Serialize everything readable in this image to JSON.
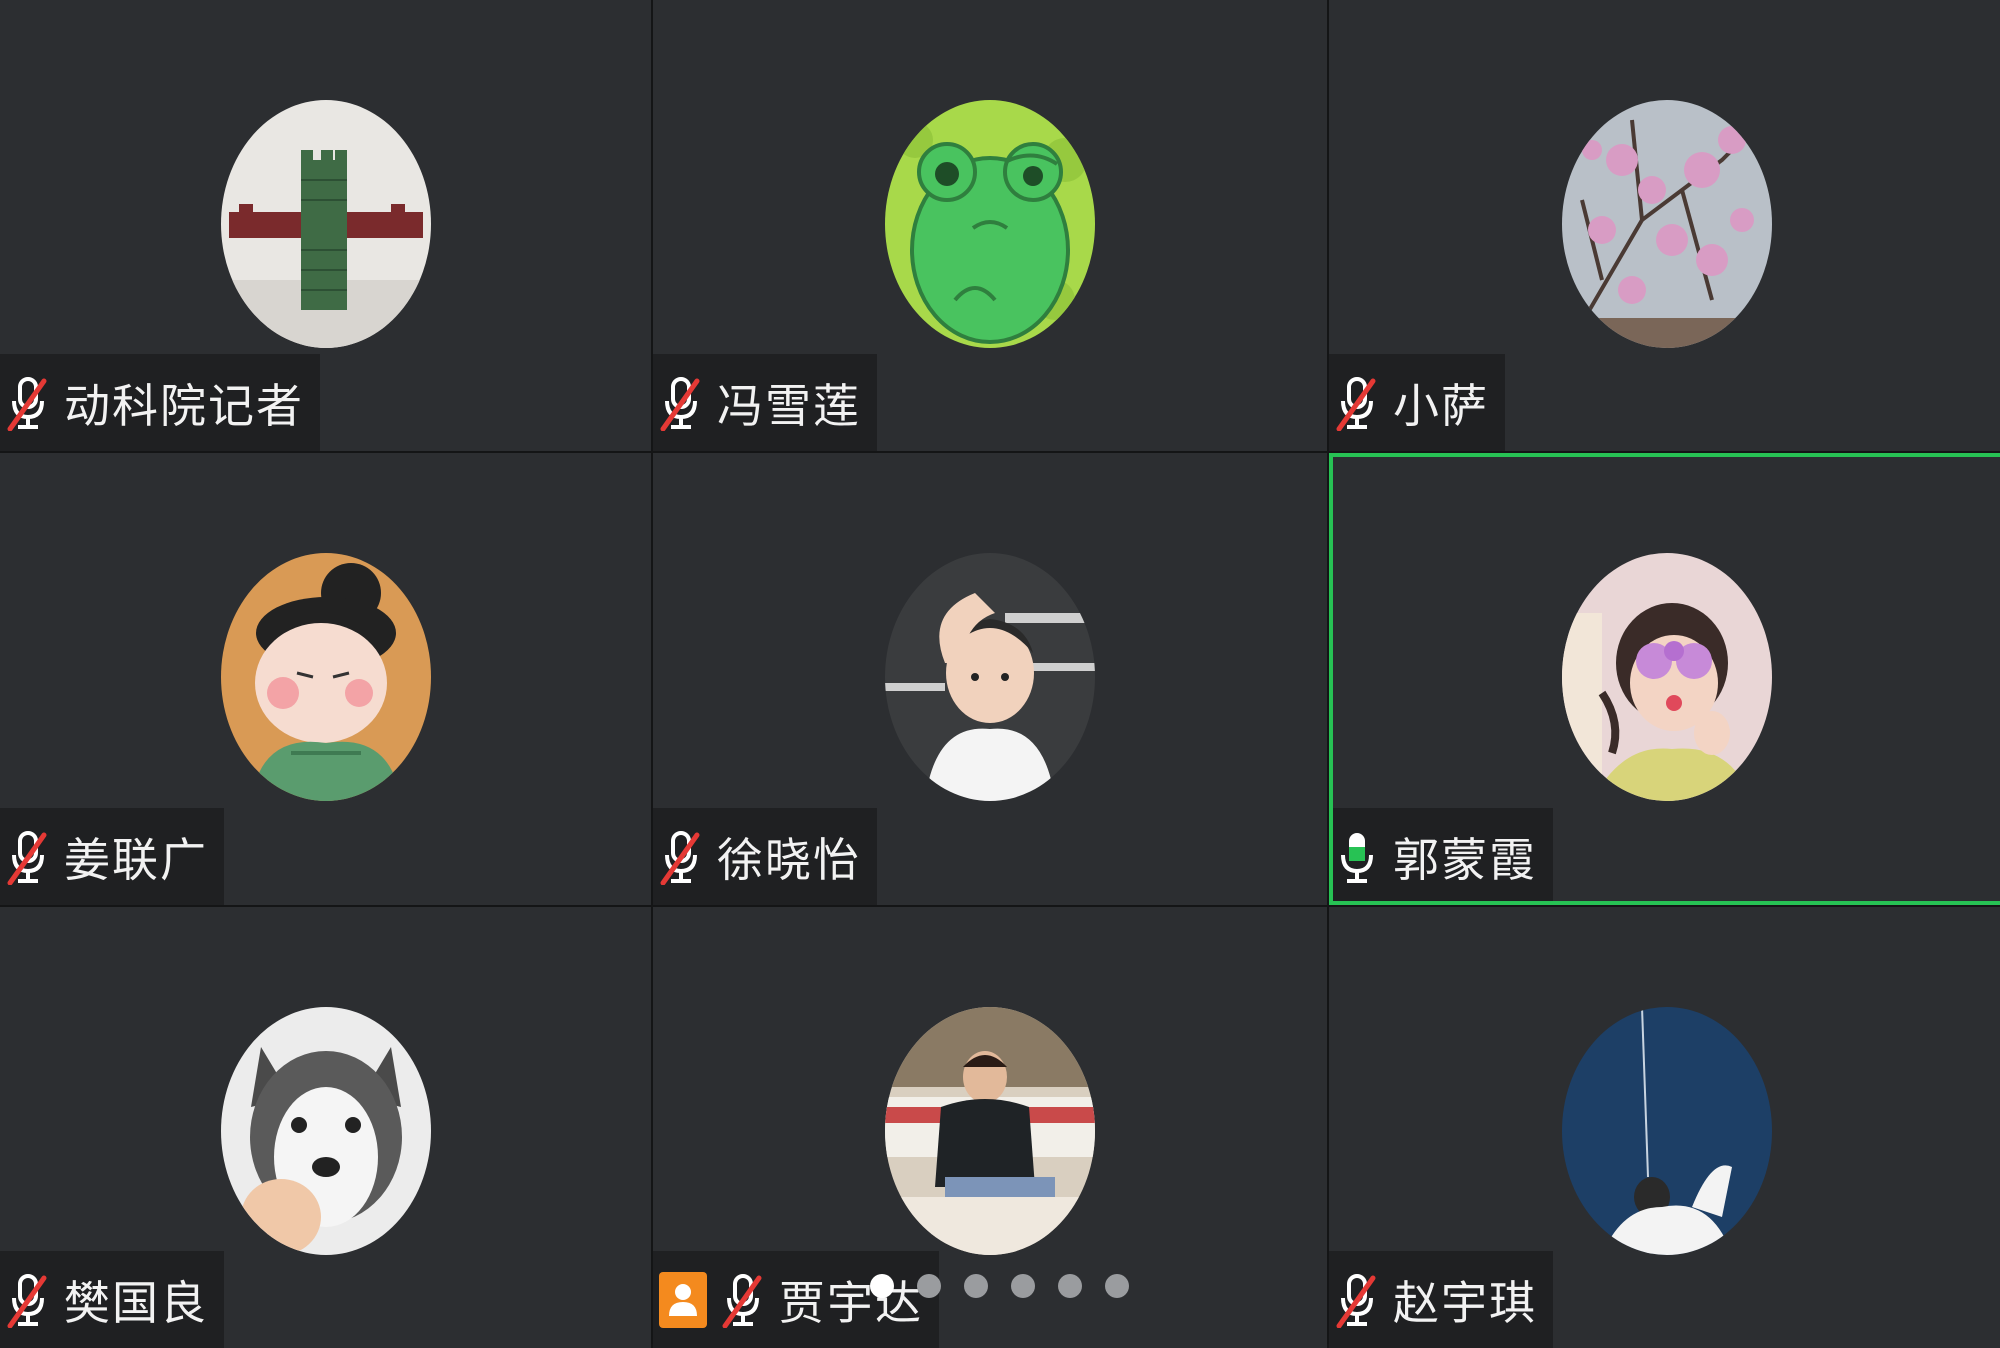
{
  "participants": [
    {
      "name": "动科院记者",
      "mic": "muted",
      "avatar": "lego-brick-avatar"
    },
    {
      "name": "冯雪莲",
      "mic": "muted",
      "avatar": "frog-avatar"
    },
    {
      "name": "小萨",
      "mic": "muted",
      "avatar": "cherry-blossom-avatar"
    },
    {
      "name": "姜联广",
      "mic": "muted",
      "avatar": "cartoon-girl-avatar"
    },
    {
      "name": "徐晓怡",
      "mic": "muted",
      "avatar": "toddler-avatar"
    },
    {
      "name": "郭蒙霞",
      "mic": "active",
      "avatar": "girl-flower-glasses-avatar",
      "speaking": true
    },
    {
      "name": "樊国良",
      "mic": "muted",
      "avatar": "husky-avatar"
    },
    {
      "name": "贾宇达",
      "mic": "muted",
      "avatar": "man-on-couch-avatar",
      "host": true
    },
    {
      "name": "赵宇琪",
      "mic": "muted",
      "avatar": "blue-sky-avatar"
    }
  ],
  "pagination": {
    "count": 6,
    "current": 1
  },
  "colors": {
    "tile_bg": "#2c2e31",
    "nameplate_bg": "#1f2022",
    "speaking_border": "#27c254",
    "mic_active": "#27c254",
    "mic_muted_slash": "#e53935",
    "host_badge": "#f48a1e"
  }
}
